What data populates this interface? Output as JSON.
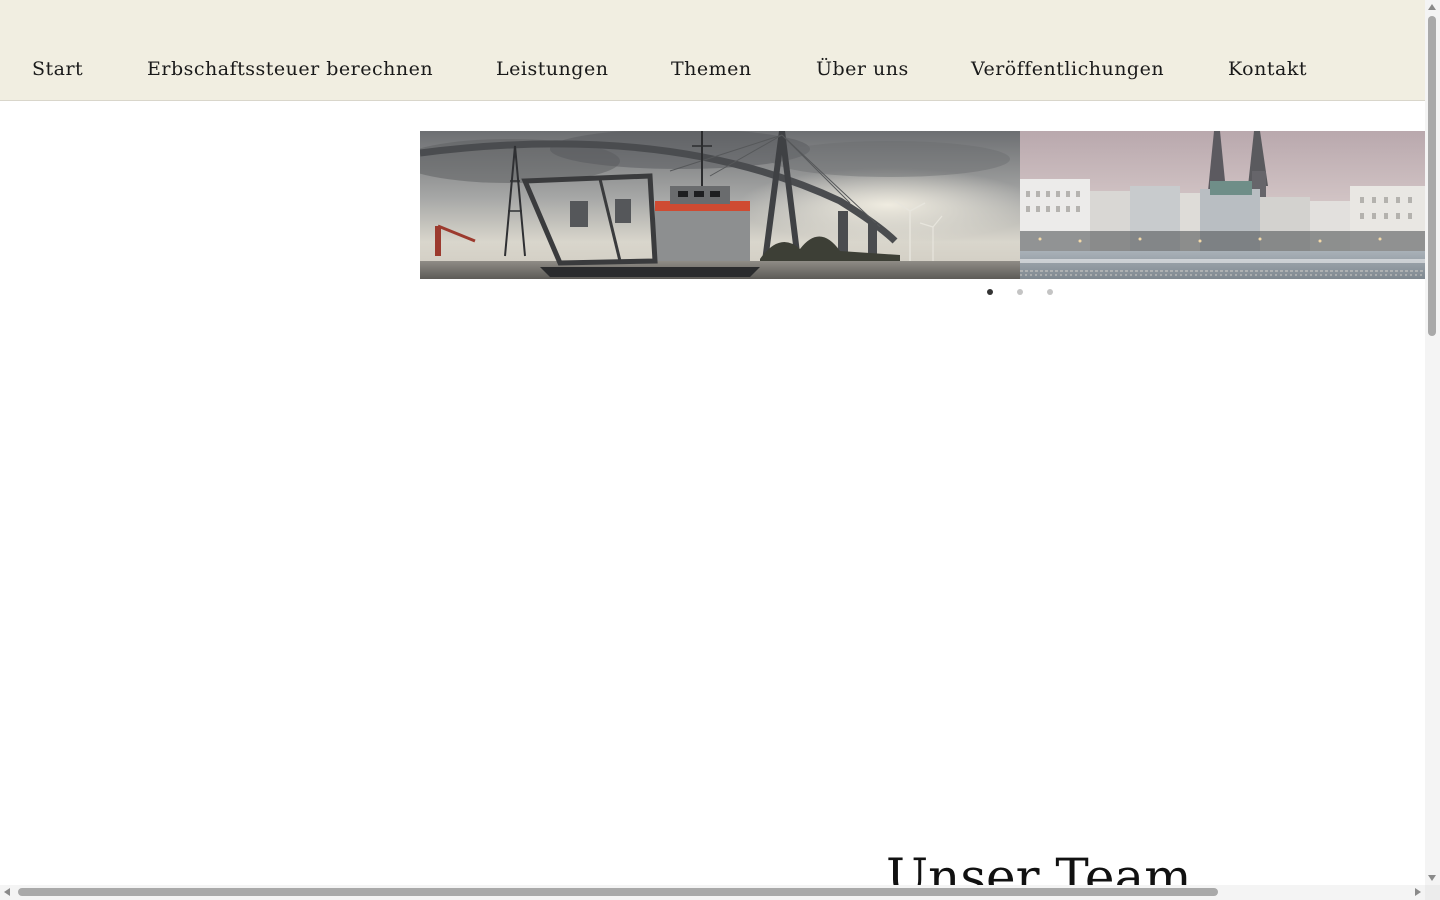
{
  "nav": {
    "items": [
      {
        "label": "Start"
      },
      {
        "label": "Erbschaftssteuer berechnen"
      },
      {
        "label": "Leistungen"
      },
      {
        "label": "Themen"
      },
      {
        "label": "Über uns"
      },
      {
        "label": "Veröffentlichungen"
      },
      {
        "label": "Kontakt"
      }
    ]
  },
  "slider": {
    "slides": [
      {
        "image": "harbor-bridge-ship-photo"
      },
      {
        "image": "city-skyline-waterfront-photo"
      }
    ],
    "active_index": 0,
    "dot_count": 3
  },
  "team": {
    "heading": "Unser Team"
  },
  "colors": {
    "nav_background": "#f1eee1",
    "dot_active": "#333333",
    "dot_inactive": "#c4c4c4"
  }
}
